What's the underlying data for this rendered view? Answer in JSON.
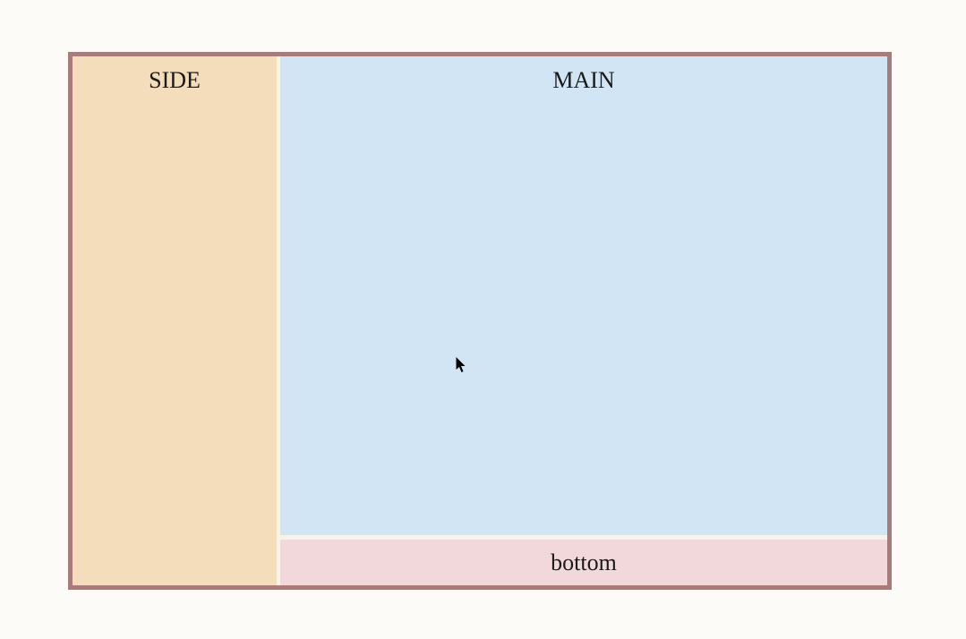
{
  "layout": {
    "side": {
      "label": "SIDE"
    },
    "main": {
      "label": "MAIN"
    },
    "bottom": {
      "label": "bottom"
    }
  },
  "colors": {
    "border": "#a97b7b",
    "side_bg": "#f3ddbb",
    "main_bg": "#d1e5f4",
    "bottom_bg": "#f3d8db",
    "page_bg": "#fcfbf8"
  }
}
